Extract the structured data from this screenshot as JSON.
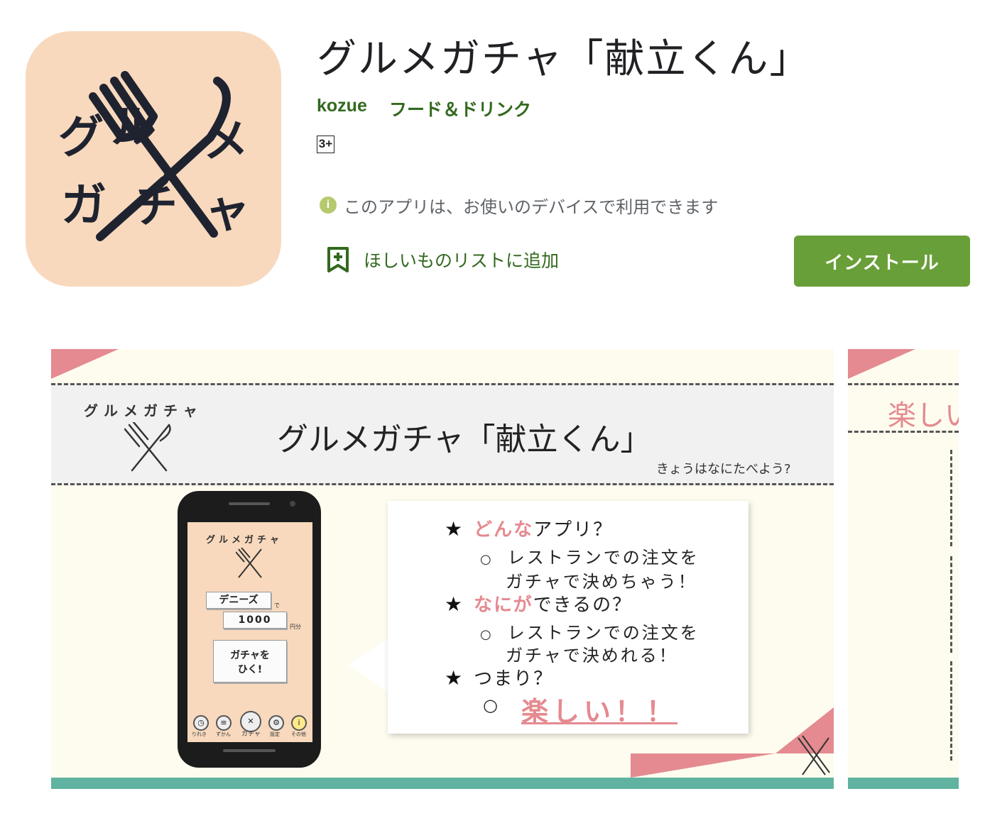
{
  "app": {
    "title": "グルメガチャ「献立くん」",
    "developer": "kozue",
    "category": "フード＆ドリンク",
    "rating": "3+",
    "compat_text": "このアプリは、お使いのデバイスで利用できます",
    "wishlist_label": "ほしいものリストに追加",
    "install_label": "インストール",
    "icon_chars": [
      "グ",
      "ル",
      "メ",
      "ガ",
      "チ",
      "ャ"
    ]
  },
  "screenshot1": {
    "mini_logo": "グルメガチャ",
    "banner_title": "グルメガチャ「献立くん」",
    "banner_sub": "きょうはなにたべよう?",
    "phone": {
      "logo": "グルメガチャ",
      "restaurant": "デニーズ",
      "de": "で",
      "amount": "1000",
      "yen": "円分",
      "gacha_line1": "ガチャを",
      "gacha_line2": "ひく!",
      "nav": [
        "りれき",
        "ずかん",
        "ガチャ",
        "設定",
        "その他"
      ]
    },
    "bubble": {
      "q1_pink": "どんな",
      "q1_rest": "アプリ？",
      "a1_line1": "レストランでの注文を",
      "a1_line2": "ガチャで決めちゃう！",
      "q2_pink": "なにが",
      "q2_rest": "できるの？",
      "a2_line1": "レストランでの注文を",
      "a2_line2": "ガチャで決めれる！",
      "q3": "つまり？",
      "fun": "楽しい！！",
      "star": "★",
      "bullet": "○"
    }
  },
  "screenshot2": {
    "banner_text": "楽しい"
  },
  "colors": {
    "accent_green": "#689f38",
    "text_green": "#33691e",
    "icon_bg": "#f8d9bd",
    "pink": "#e48a90",
    "teal": "#5fb3a0"
  }
}
